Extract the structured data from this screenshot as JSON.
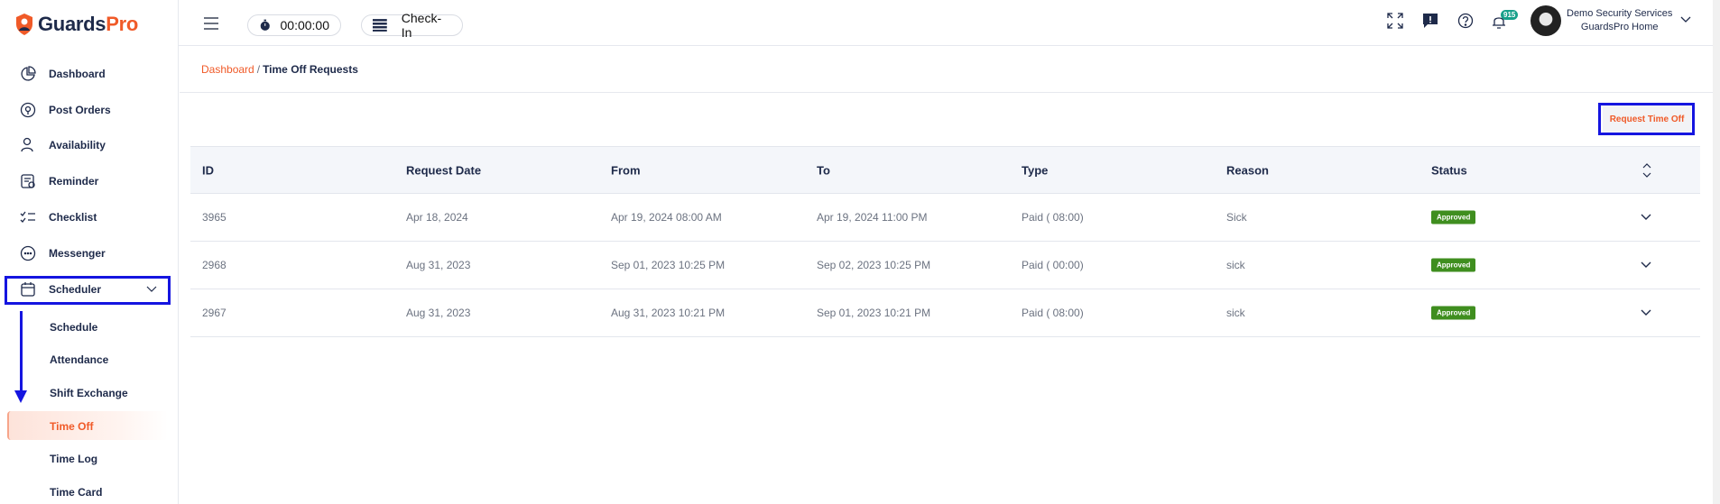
{
  "app": {
    "logo_left": "Guards",
    "logo_right": "Pro"
  },
  "sidebar": {
    "items": [
      {
        "label": "Dashboard",
        "icon": "dashboard-icon"
      },
      {
        "label": "Post Orders",
        "icon": "post-orders-icon"
      },
      {
        "label": "Availability",
        "icon": "availability-icon"
      },
      {
        "label": "Reminder",
        "icon": "reminder-icon"
      },
      {
        "label": "Checklist",
        "icon": "checklist-icon"
      },
      {
        "label": "Messenger",
        "icon": "messenger-icon"
      },
      {
        "label": "Scheduler",
        "icon": "calendar-icon"
      }
    ],
    "subitems": [
      {
        "label": "Schedule"
      },
      {
        "label": "Attendance"
      },
      {
        "label": "Shift Exchange"
      },
      {
        "label": "Time Off"
      },
      {
        "label": "Time Log"
      },
      {
        "label": "Time Card"
      }
    ],
    "active_subitem": "Time Off"
  },
  "topbar": {
    "timer": "00:00:00",
    "checkin_label": "Check-In",
    "notification_count": "915",
    "user_company": "Demo Security Services",
    "user_location": "GuardsPro Home"
  },
  "breadcrumb": {
    "parent": "Dashboard",
    "separator": "/",
    "current": "Time Off Requests"
  },
  "actions": {
    "request_label": "Request Time Off"
  },
  "table": {
    "headers": [
      "ID",
      "Request Date",
      "From",
      "To",
      "Type",
      "Reason",
      "Status"
    ],
    "rows": [
      {
        "id": "3965",
        "request_date": "Apr 18, 2024",
        "from": "Apr 19, 2024 08:00 AM",
        "to": "Apr 19, 2024 11:00 PM",
        "type": "Paid ( 08:00)",
        "reason": "Sick",
        "status": "Approved"
      },
      {
        "id": "2968",
        "request_date": "Aug 31, 2023",
        "from": "Sep 01, 2023 10:25 PM",
        "to": "Sep 02, 2023 10:25 PM",
        "type": "Paid ( 00:00)",
        "reason": "sick",
        "status": "Approved"
      },
      {
        "id": "2967",
        "request_date": "Aug 31, 2023",
        "from": "Aug 31, 2023 10:21 PM",
        "to": "Sep 01, 2023 10:21 PM",
        "type": "Paid ( 08:00)",
        "reason": "sick",
        "status": "Approved"
      }
    ]
  },
  "colors": {
    "accent": "#f05a28",
    "navy": "#1e2a4a",
    "approved": "#3f8e1f",
    "annotation": "#1515e0"
  }
}
